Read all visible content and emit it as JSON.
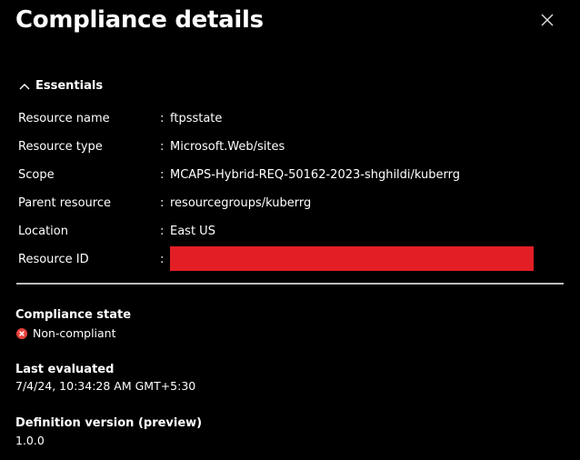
{
  "panel": {
    "title": "Compliance details"
  },
  "essentials": {
    "label": "Essentials",
    "separator": ":",
    "rows": [
      {
        "key": "Resource name",
        "value": "ftpsstate"
      },
      {
        "key": "Resource type",
        "value": "Microsoft.Web/sites"
      },
      {
        "key": "Scope",
        "value": "MCAPS-Hybrid-REQ-50162-2023-shghildi/kuberrg"
      },
      {
        "key": "Parent resource",
        "value": "resourcegroups/kuberrg"
      },
      {
        "key": "Location",
        "value": "East US"
      },
      {
        "key": "Resource ID",
        "value": ""
      }
    ]
  },
  "compliance": {
    "title": "Compliance state",
    "state": "Non-compliant",
    "state_icon": "error-circle-icon",
    "state_color": "#e8413a"
  },
  "last_evaluated": {
    "title": "Last evaluated",
    "value": "7/4/24, 10:34:28 AM GMT+5:30"
  },
  "definition_version": {
    "title": "Definition version (preview)",
    "value": "1.0.0"
  },
  "colors": {
    "background": "#000000",
    "text": "#ffffff",
    "redaction": "#e31e24",
    "divider": "#bdbdbd"
  }
}
